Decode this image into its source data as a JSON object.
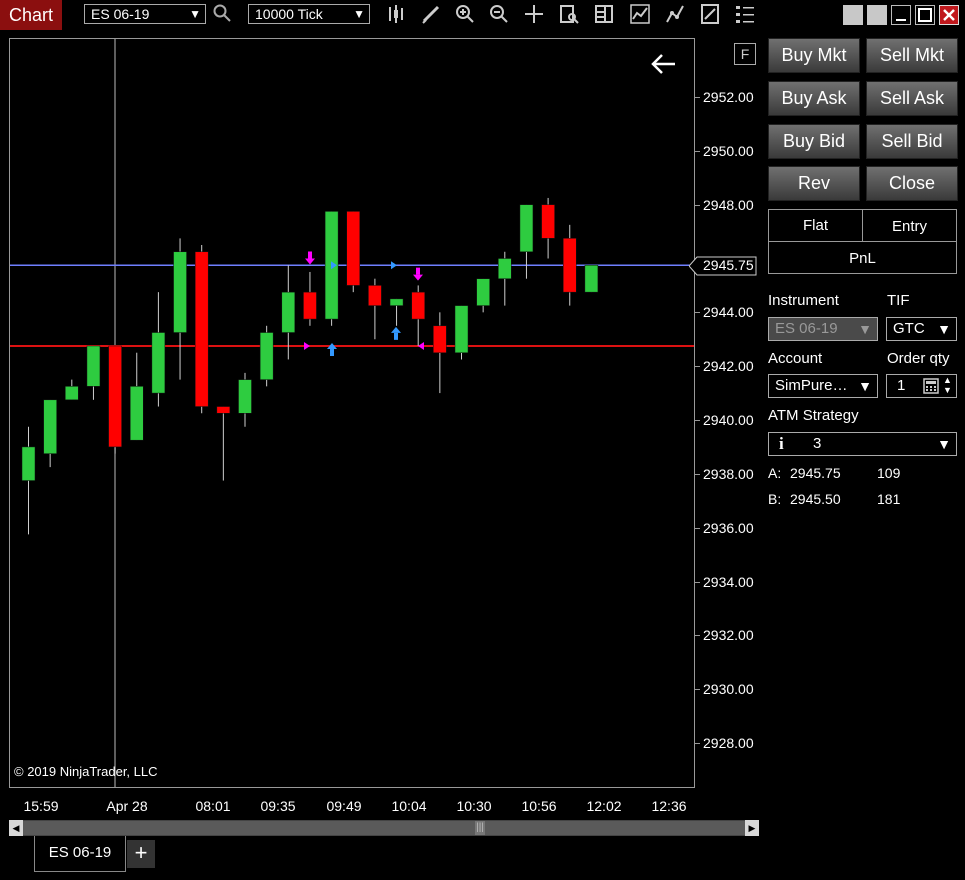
{
  "window": {
    "title": "Chart"
  },
  "toolbar": {
    "instrument": "ES 06-19",
    "interval": "10000 Tick"
  },
  "chart": {
    "copyright": "© 2019 NinjaTrader, LLC",
    "f_label": "F",
    "current_price_label": "2945.75"
  },
  "chart_data": {
    "type": "candlestick",
    "y_ticks": [
      "2952.00",
      "2950.00",
      "2948.00",
      "2946.00",
      "2944.00",
      "2942.00",
      "2940.00",
      "2938.00",
      "2936.00",
      "2934.00",
      "2932.00",
      "2930.00",
      "2928.00"
    ],
    "x_ticks": [
      "15:59",
      "Apr 28",
      "08:01",
      "09:35",
      "09:49",
      "10:04",
      "10:30",
      "10:56",
      "12:02",
      "12:36"
    ],
    "ylim": [
      2926.0,
      2953.5
    ],
    "bid_line": 2945.75,
    "order_line": 2942.75,
    "candles": [
      {
        "o": 2937.75,
        "h": 2939.75,
        "l": 2935.75,
        "c": 2939.0
      },
      {
        "o": 2938.75,
        "h": 2940.75,
        "l": 2938.25,
        "c": 2940.75
      },
      {
        "o": 2940.75,
        "h": 2941.5,
        "l": 2940.75,
        "c": 2941.25
      },
      {
        "o": 2941.25,
        "h": 2942.75,
        "l": 2940.75,
        "c": 2942.75
      },
      {
        "o": 2942.75,
        "h": 2942.75,
        "l": 2938.75,
        "c": 2939.0
      },
      {
        "o": 2939.25,
        "h": 2942.5,
        "l": 2939.25,
        "c": 2941.25
      },
      {
        "o": 2941.0,
        "h": 2944.75,
        "l": 2940.5,
        "c": 2943.25
      },
      {
        "o": 2943.25,
        "h": 2946.75,
        "l": 2941.5,
        "c": 2946.25
      },
      {
        "o": 2946.25,
        "h": 2946.5,
        "l": 2940.25,
        "c": 2940.5
      },
      {
        "o": 2940.5,
        "h": 2940.5,
        "l": 2937.75,
        "c": 2940.25
      },
      {
        "o": 2940.25,
        "h": 2941.75,
        "l": 2939.75,
        "c": 2941.5
      },
      {
        "o": 2941.5,
        "h": 2943.5,
        "l": 2941.25,
        "c": 2943.25
      },
      {
        "o": 2943.25,
        "h": 2945.75,
        "l": 2942.25,
        "c": 2944.75
      },
      {
        "o": 2944.75,
        "h": 2945.5,
        "l": 2943.5,
        "c": 2943.75
      },
      {
        "o": 2943.75,
        "h": 2947.75,
        "l": 2943.5,
        "c": 2947.75
      },
      {
        "o": 2947.75,
        "h": 2947.75,
        "l": 2944.75,
        "c": 2945.0
      },
      {
        "o": 2945.0,
        "h": 2945.25,
        "l": 2943.0,
        "c": 2944.25
      },
      {
        "o": 2944.25,
        "h": 2944.5,
        "l": 2943.5,
        "c": 2944.5
      },
      {
        "o": 2944.75,
        "h": 2945.0,
        "l": 2942.75,
        "c": 2943.75
      },
      {
        "o": 2943.5,
        "h": 2944.0,
        "l": 2941.0,
        "c": 2942.5
      },
      {
        "o": 2942.5,
        "h": 2944.25,
        "l": 2942.25,
        "c": 2944.25
      },
      {
        "o": 2944.25,
        "h": 2945.25,
        "l": 2944.0,
        "c": 2945.25
      },
      {
        "o": 2945.25,
        "h": 2946.25,
        "l": 2944.25,
        "c": 2946.0
      },
      {
        "o": 2946.25,
        "h": 2948.0,
        "l": 2945.25,
        "c": 2948.0
      },
      {
        "o": 2948.0,
        "h": 2948.25,
        "l": 2946.0,
        "c": 2946.75
      },
      {
        "o": 2946.75,
        "h": 2947.25,
        "l": 2944.25,
        "c": 2944.75
      },
      {
        "o": 2944.75,
        "h": 2945.75,
        "l": 2944.75,
        "c": 2945.75
      }
    ],
    "colors": {
      "up": "#2ecc40",
      "down": "#ff0000",
      "bid_line": "#6f7fff",
      "order_line": "#dd1111"
    }
  },
  "order_panel": {
    "buy_mkt": "Buy Mkt",
    "sell_mkt": "Sell Mkt",
    "buy_ask": "Buy Ask",
    "sell_ask": "Sell Ask",
    "buy_bid": "Buy Bid",
    "sell_bid": "Sell Bid",
    "rev": "Rev",
    "close": "Close",
    "flat": "Flat",
    "entry": "Entry",
    "pnl": "PnL",
    "instrument_label": "Instrument",
    "instrument_value": "ES 06-19",
    "tif_label": "TIF",
    "tif_value": "GTC",
    "account_label": "Account",
    "account_value": "SimPure…",
    "qty_label": "Order qty",
    "qty_value": "1",
    "atm_label": "ATM Strategy",
    "atm_value": "3",
    "ask_label": "A:",
    "ask_price": "2945.75",
    "ask_size": "109",
    "bid_label": "B:",
    "bid_price": "2945.50",
    "bid_size": "181"
  },
  "tabs": {
    "instrument_tab": "ES 06-19",
    "add_tab": "+"
  }
}
